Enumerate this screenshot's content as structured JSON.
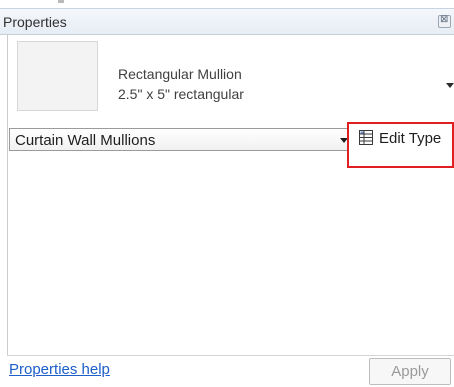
{
  "panel": {
    "title": "Properties"
  },
  "type_selector": {
    "family_name": "Rectangular Mullion",
    "type_name": "2.5\" x 5\" rectangular"
  },
  "category_filter": {
    "selected": "Curtain Wall Mullions"
  },
  "edit_type": {
    "label": "Edit Type",
    "highlight_color": "#e02020"
  },
  "footer": {
    "help_link": "Properties help",
    "apply_label": "Apply"
  },
  "icons": {
    "close": "close-icon",
    "edit_type": "edit-type-icon",
    "dropdown": "chevron-down-icon"
  }
}
